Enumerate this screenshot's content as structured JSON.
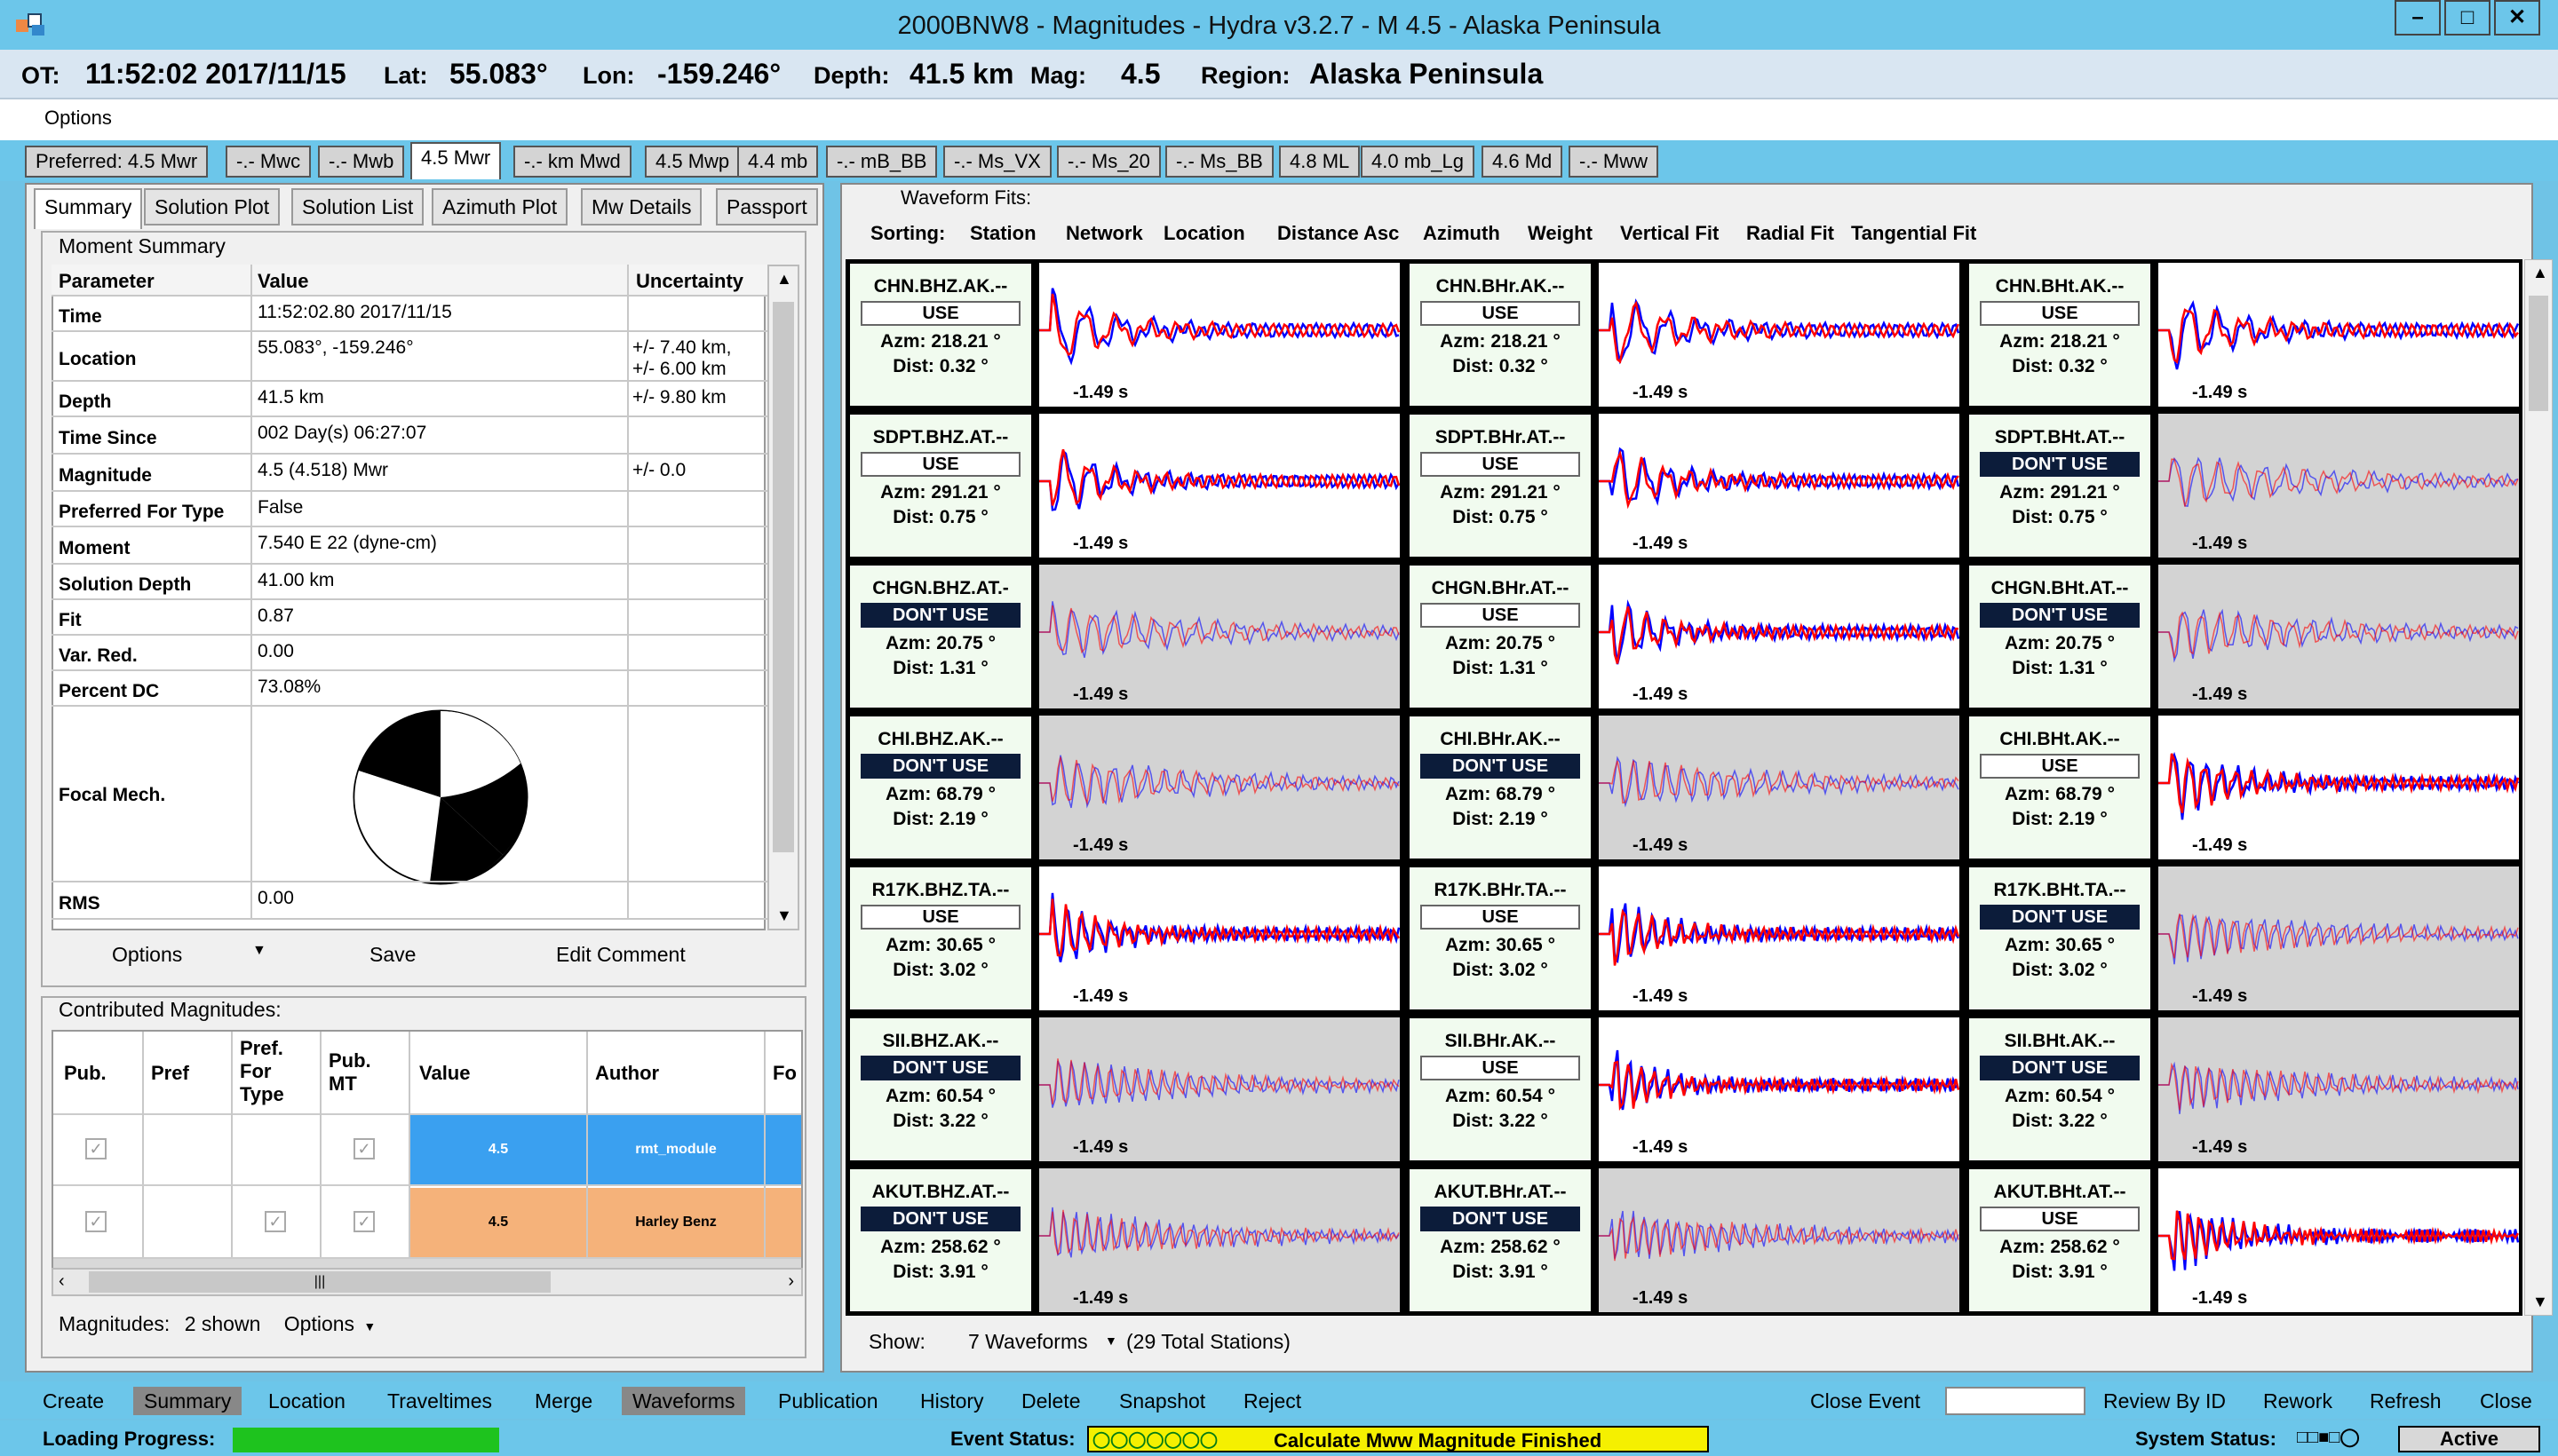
{
  "window": {
    "title": "2000BNW8 - Magnitudes - Hydra v3.2.7 -  M 4.5  - Alaska Peninsula"
  },
  "info": {
    "ot_label": "OT:",
    "ot_value": "11:52:02 2017/11/15",
    "lat_label": "Lat:",
    "lat_value": "55.083°",
    "lon_label": "Lon:",
    "lon_value": "-159.246°",
    "depth_label": "Depth:",
    "depth_value": "41.5 km",
    "mag_label": "Mag:",
    "mag_value": "4.5",
    "region_label": "Region:",
    "region_value": "Alaska Peninsula"
  },
  "menu": {
    "options": "Options"
  },
  "mag_tabs": [
    "Preferred: 4.5 Mwr",
    "-.- Mwc",
    "-.- Mwb",
    "4.5 Mwr",
    "-.- km Mwd",
    "4.5 Mwp",
    "4.4 mb",
    "-.- mB_BB",
    "-.- Ms_VX",
    "-.- Ms_20",
    "-.- Ms_BB",
    "4.8 ML",
    "4.0 mb_Lg",
    "4.6 Md",
    "-.- Mww"
  ],
  "sub_tabs": [
    "Summary",
    "Solution Plot",
    "Solution List",
    "Azimuth Plot",
    "Mw Details",
    "Passport"
  ],
  "moment": {
    "header": "Moment Summary",
    "col_param": "Parameter",
    "col_value": "Value",
    "col_unc": "Uncertainty",
    "rows": [
      {
        "p": "Time",
        "v": "11:52:02.80 2017/11/15",
        "u": ""
      },
      {
        "p": "Location",
        "v": "55.083°, -159.246°",
        "u": "+/- 7.40 km,",
        "u2": "+/- 6.00 km"
      },
      {
        "p": "Depth",
        "v": "41.5 km",
        "u": "+/- 9.80 km"
      },
      {
        "p": "Time Since",
        "v": "002 Day(s) 06:27:07",
        "u": ""
      },
      {
        "p": "Magnitude",
        "v": "4.5 (4.518) Mwr",
        "u": "+/- 0.0"
      },
      {
        "p": "Preferred For Type",
        "v": "False",
        "u": ""
      },
      {
        "p": "Moment",
        "v": "7.540 E 22 (dyne-cm)",
        "u": ""
      },
      {
        "p": "Solution Depth",
        "v": "41.00 km",
        "u": ""
      },
      {
        "p": "Fit",
        "v": "0.87",
        "u": ""
      },
      {
        "p": "Var. Red.",
        "v": "0.00",
        "u": ""
      },
      {
        "p": "Percent DC",
        "v": "73.08%",
        "u": ""
      },
      {
        "p": "Focal Mech.",
        "v": "",
        "u": ""
      },
      {
        "p": "RMS",
        "v": "0.00",
        "u": ""
      }
    ],
    "btn_options": "Options",
    "btn_save": "Save",
    "btn_edit": "Edit Comment"
  },
  "contrib": {
    "header": "Contributed Magnitudes:",
    "cols": [
      "Pub.",
      "Pref",
      "Pref.",
      "For",
      "Type",
      "Pub.",
      "MT",
      "Value",
      "Author",
      "Fo"
    ],
    "rows": [
      {
        "value": "4.5",
        "author": "rmt_module",
        "color": "#3aa0f0"
      },
      {
        "value": "4.5",
        "author": "Harley Benz",
        "color": "#f5b27a"
      }
    ],
    "footer_label": "Magnitudes:",
    "footer_count": "2 shown",
    "footer_options": "Options"
  },
  "waveform": {
    "header": "Waveform Fits:",
    "sorting_label": "Sorting:",
    "sort_items": [
      "Station",
      "Network",
      "Location",
      "Distance Asc",
      "Azimuth",
      "Weight",
      "Vertical Fit",
      "Radial Fit",
      "Tangential Fit"
    ],
    "time_label": "-1.49 s",
    "azm_prefix": "Azm:",
    "dist_prefix": "Dist:",
    "use_text": "USE",
    "dont_text": "DON'T USE",
    "rows": [
      {
        "az": "218.21 °",
        "dist": "0.32 °",
        "cells": [
          {
            "name": "CHN.BHZ.AK.--",
            "use": true
          },
          {
            "name": "CHN.BHr.AK.--",
            "use": true
          },
          {
            "name": "CHN.BHt.AK.--",
            "use": true
          }
        ]
      },
      {
        "az": "291.21 °",
        "dist": "0.75 °",
        "cells": [
          {
            "name": "SDPT.BHZ.AT.--",
            "use": true
          },
          {
            "name": "SDPT.BHr.AT.--",
            "use": true
          },
          {
            "name": "SDPT.BHt.AT.--",
            "use": false
          }
        ]
      },
      {
        "az": "20.75 °",
        "dist": "1.31 °",
        "cells": [
          {
            "name": "CHGN.BHZ.AT.-",
            "use": false
          },
          {
            "name": "CHGN.BHr.AT.--",
            "use": true
          },
          {
            "name": "CHGN.BHt.AT.--",
            "use": false
          }
        ]
      },
      {
        "az": "68.79 °",
        "dist": "2.19 °",
        "cells": [
          {
            "name": "CHI.BHZ.AK.--",
            "use": false
          },
          {
            "name": "CHI.BHr.AK.--",
            "use": false
          },
          {
            "name": "CHI.BHt.AK.--",
            "use": true
          }
        ]
      },
      {
        "az": "30.65 °",
        "dist": "3.02 °",
        "cells": [
          {
            "name": "R17K.BHZ.TA.--",
            "use": true
          },
          {
            "name": "R17K.BHr.TA.--",
            "use": true
          },
          {
            "name": "R17K.BHt.TA.--",
            "use": false
          }
        ]
      },
      {
        "az": "60.54 °",
        "dist": "3.22 °",
        "cells": [
          {
            "name": "SII.BHZ.AK.--",
            "use": false
          },
          {
            "name": "SII.BHr.AK.--",
            "use": true
          },
          {
            "name": "SII.BHt.AK.--",
            "use": false
          }
        ]
      },
      {
        "az": "258.62 °",
        "dist": "3.91 °",
        "cells": [
          {
            "name": "AKUT.BHZ.AT.--",
            "use": false
          },
          {
            "name": "AKUT.BHr.AT.--",
            "use": false
          },
          {
            "name": "AKUT.BHt.AT.--",
            "use": true
          }
        ]
      }
    ],
    "show_label": "Show:",
    "show_value": "7 Waveforms",
    "show_total": "(29 Total Stations)"
  },
  "bottom": {
    "buttons": [
      "Create",
      "Summary",
      "Location",
      "Traveltimes",
      "Merge",
      "Waveforms",
      "Publication",
      "History",
      "Delete",
      "Snapshot",
      "Reject"
    ],
    "close_event": "Close Event",
    "review_by_id": "Review By ID",
    "rework": "Rework",
    "refresh": "Refresh",
    "close": "Close"
  },
  "status": {
    "loading_label": "Loading Progress:",
    "event_status_label": "Event Status:",
    "event_status_msg": "Calculate Mww Magnitude Finished",
    "system_status_label": "System Status:",
    "system_status_value": "Active",
    "colors": {
      "progress": "#1ec31e",
      "status_msg_bg": "#f5f000"
    }
  }
}
